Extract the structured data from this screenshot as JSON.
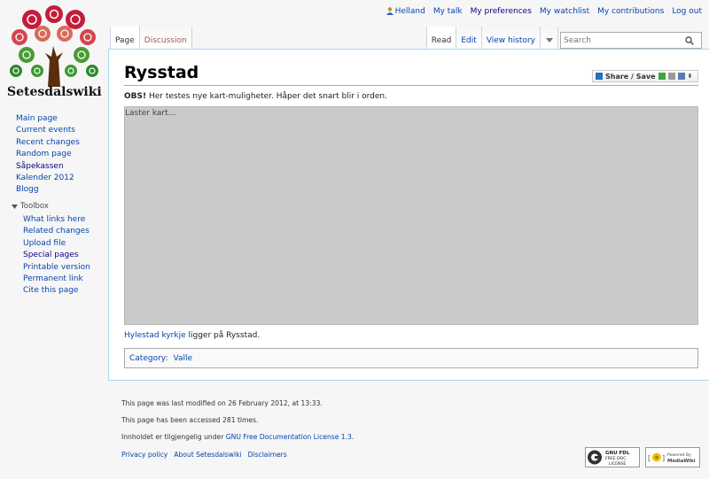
{
  "site": {
    "name": "Setesdalswiki"
  },
  "personal": {
    "user": "Helland",
    "items": [
      "My talk",
      "My preferences",
      "My watchlist",
      "My contributions",
      "Log out"
    ]
  },
  "tabs": {
    "left": [
      "Page",
      "Discussion"
    ],
    "right": [
      "Read",
      "Edit",
      "View history"
    ]
  },
  "search": {
    "placeholder": "Search"
  },
  "page": {
    "title": "Rysstad",
    "share_label": "Share / Save",
    "obs_bold": "OBS!",
    "obs_text": " Her testes nye kart-muligheter. Håper det snart blir i orden.",
    "map_loading": "Laster kart...",
    "church_link1": "Hylestad",
    "church_link2": "kyrkje",
    "church_text": " ligger på Rysstad.",
    "category_label": "Category",
    "category_value": "Valle"
  },
  "navigation": [
    "Main page",
    "Current events",
    "Recent changes",
    "Random page",
    "Såpekassen",
    "Kalender 2012",
    "Blogg"
  ],
  "toolbox": {
    "heading": "Toolbox",
    "items": [
      "What links here",
      "Related changes",
      "Upload file",
      "Special pages",
      "Printable version",
      "Permanent link",
      "Cite this page"
    ]
  },
  "footer": {
    "modified": "This page was last modified on 26 February 2012, at 13:33.",
    "accessed": "This page has been accessed 281 times.",
    "license_prefix": "Innholdet er tilgjengelig under ",
    "license_link": "GNU Free Documentation License 1.3",
    "license_suffix": ".",
    "links": [
      "Privacy policy",
      "About Setesdalswiki",
      "Disclaimers"
    ],
    "badge_gfdl": [
      "GNU FDL",
      "FREE DOC",
      "LICENSE"
    ],
    "badge_mw": [
      "Powered By",
      "MediaWiki"
    ]
  },
  "colors": {
    "link": "#0645ad",
    "map": "#cacaca",
    "tab_border": "#c8d6e6"
  }
}
